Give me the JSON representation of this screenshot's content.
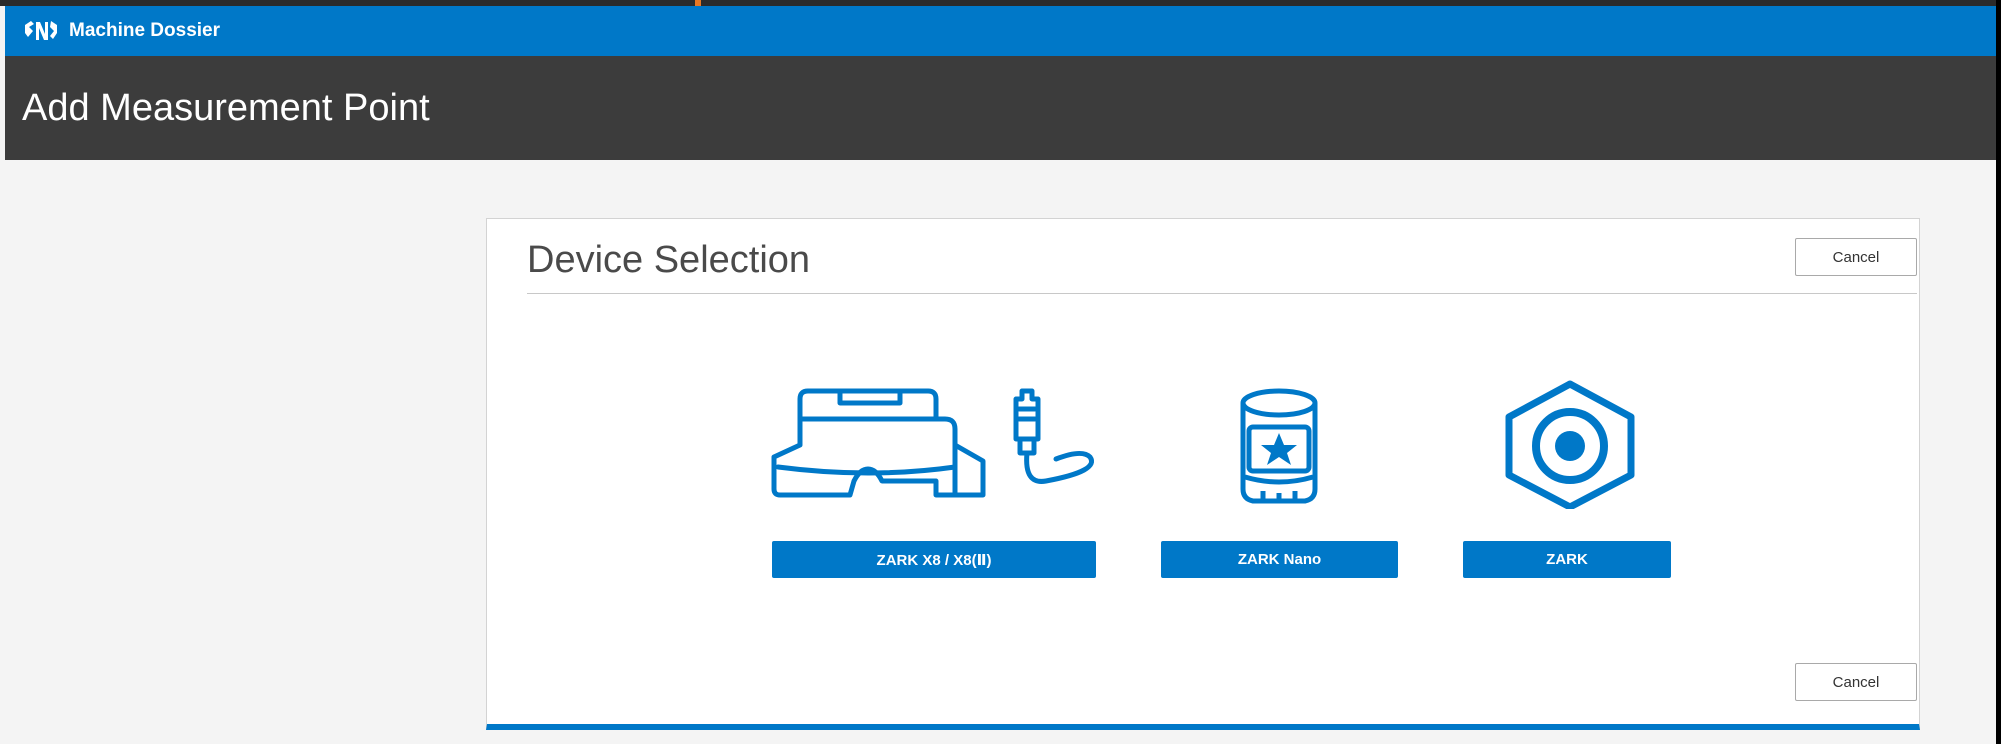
{
  "app": {
    "name": "Machine Dossier",
    "logo_icon": "machine-dossier-logo-icon"
  },
  "page": {
    "title": "Add Measurement Point"
  },
  "panel": {
    "title": "Device Selection",
    "cancel_label": "Cancel",
    "devices": [
      {
        "label": "ZARK X8 / X8(Ⅱ)",
        "icon": "x8-device-with-sensor-icon"
      },
      {
        "label": "ZARK Nano",
        "icon": "nano-cylinder-star-icon"
      },
      {
        "label": "ZARK",
        "icon": "hexagon-target-icon"
      }
    ]
  },
  "colors": {
    "accent": "#0078c8",
    "titlebar": "#3c3c3c",
    "background": "#f4f4f4"
  }
}
